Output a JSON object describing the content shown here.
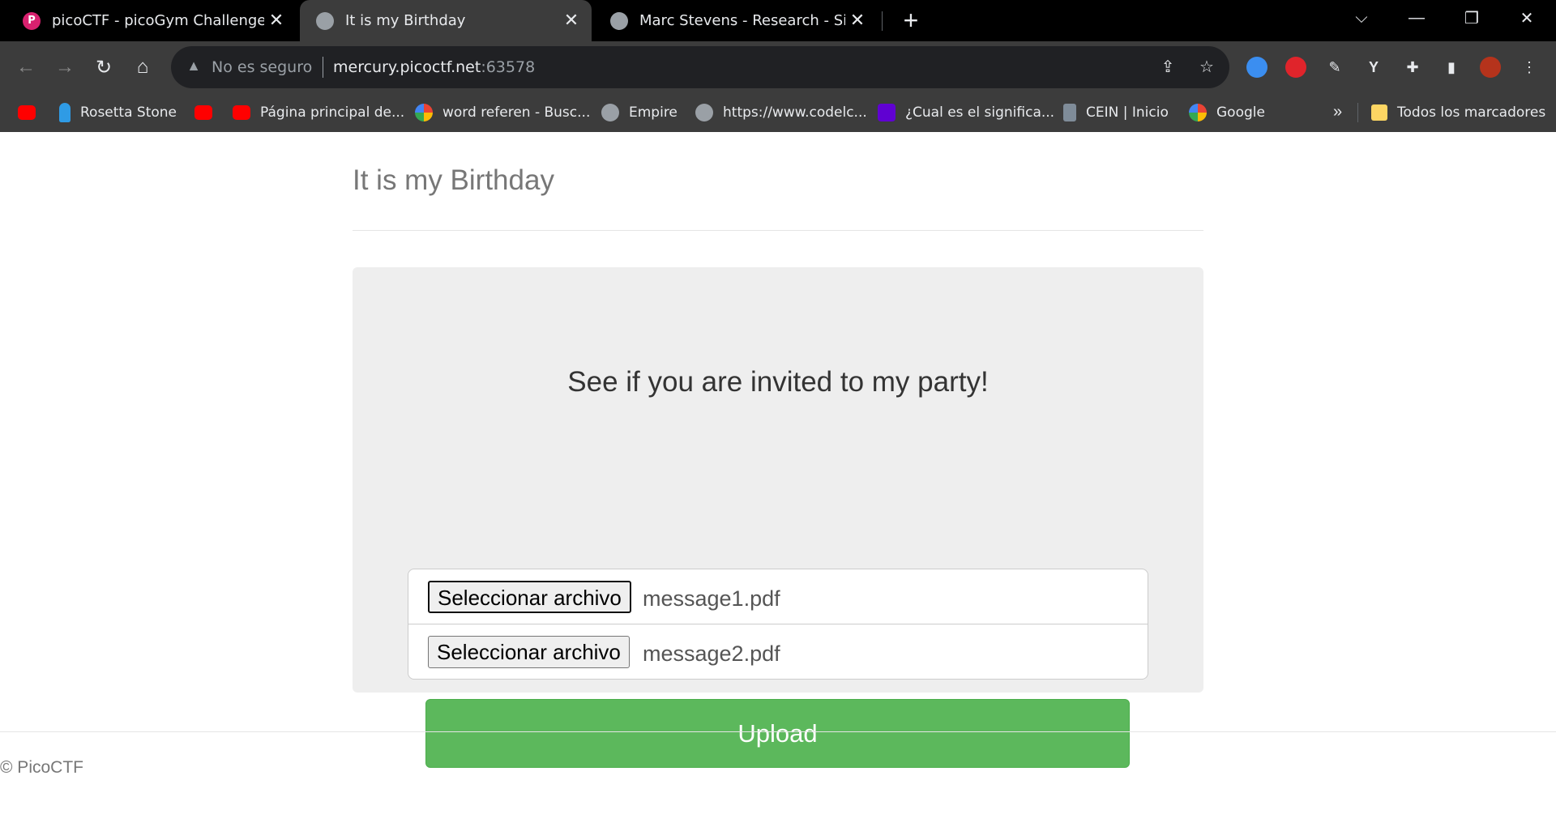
{
  "browser": {
    "tabs": [
      {
        "title": "picoCTF - picoGym Challenges",
        "favicon": "picoctf-icon",
        "active": false
      },
      {
        "title": "It is my Birthday",
        "favicon": "globe-icon",
        "active": true
      },
      {
        "title": "Marc Stevens - Research - Single",
        "favicon": "globe-icon",
        "active": false
      }
    ],
    "new_tab_label": "+",
    "address_bar": {
      "security_label": "No es seguro",
      "host": "mercury.picoctf.net",
      "port": ":63578"
    },
    "bookmarks": [
      {
        "label": "",
        "icon": "youtube-icon"
      },
      {
        "label": "Rosetta Stone",
        "icon": "rosetta-stone-icon"
      },
      {
        "label": "",
        "icon": "youtube-icon"
      },
      {
        "label": "Página principal de...",
        "icon": "youtube-icon"
      },
      {
        "label": "word referen - Busc...",
        "icon": "google-icon"
      },
      {
        "label": "Empire",
        "icon": "globe-icon"
      },
      {
        "label": "https://www.codelc...",
        "icon": "globe-icon"
      },
      {
        "label": "¿Cual es el significa...",
        "icon": "yahoo-icon"
      },
      {
        "label": "CEIN | Inicio",
        "icon": "cein-icon"
      },
      {
        "label": "Google",
        "icon": "google-icon"
      }
    ],
    "bookmarks_overflow": "»",
    "bookmarks_folder": "Todos los marcadores"
  },
  "page": {
    "header": "It is my Birthday",
    "lead": "See if you are invited to my party!",
    "file_inputs": [
      {
        "button_label": "Seleccionar archivo",
        "file_name": "message1.pdf"
      },
      {
        "button_label": "Seleccionar archivo",
        "file_name": "message2.pdf"
      }
    ],
    "upload_label": "Upload",
    "footer": "© PicoCTF"
  },
  "colors": {
    "upload_button": "#5cb85c",
    "jumbotron": "#eeeeee",
    "chrome_dark": "#3c3c3c"
  }
}
